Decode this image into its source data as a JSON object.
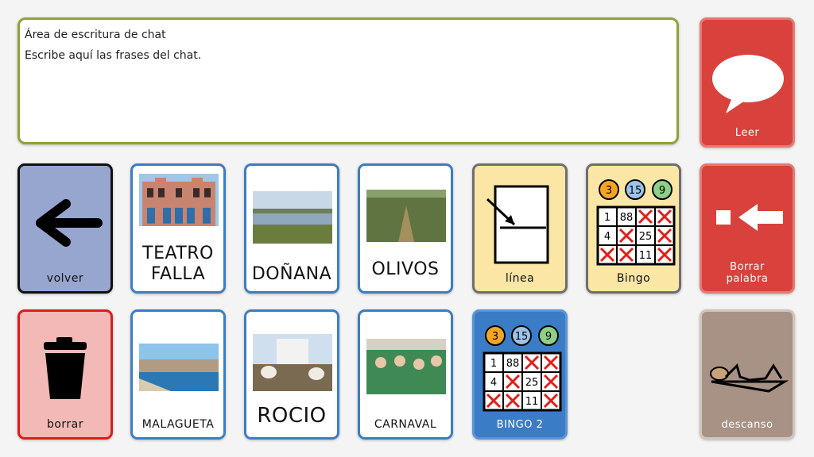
{
  "chat": {
    "title": "Área de escritura de chat",
    "placeholder": "Escribe aquí las frases del chat."
  },
  "buttons": {
    "leer": "Leer",
    "volver": "volver",
    "teatro_falla": "TEATRO FALLA",
    "donana": "DOÑANA",
    "olivos": "OLIVOS",
    "linea": "línea",
    "bingo": "Bingo",
    "borrar_palabra": "Borrar palabra",
    "borrar": "borrar",
    "malagueta": "MALAGUETA",
    "rocio": "ROCIO",
    "carnaval": "CARNAVAL",
    "bingo2": "BINGO 2",
    "descanso": "descanso"
  },
  "bingo_balls": [
    "3",
    "15",
    "9"
  ],
  "bingo_grid": [
    "1",
    "88",
    "x",
    "x",
    "4",
    "x",
    "25",
    "x",
    "x",
    "x",
    "11",
    "x"
  ],
  "colors": {
    "red": "#d9423c",
    "blue_border": "#3c7dc4",
    "yellow": "#fbe6a6",
    "nav": "#97a6cf",
    "pink": "#f3b9b6",
    "brown": "#a89285",
    "bingo2_bg": "#3a7cc6",
    "chat_border": "#8ea33a"
  }
}
